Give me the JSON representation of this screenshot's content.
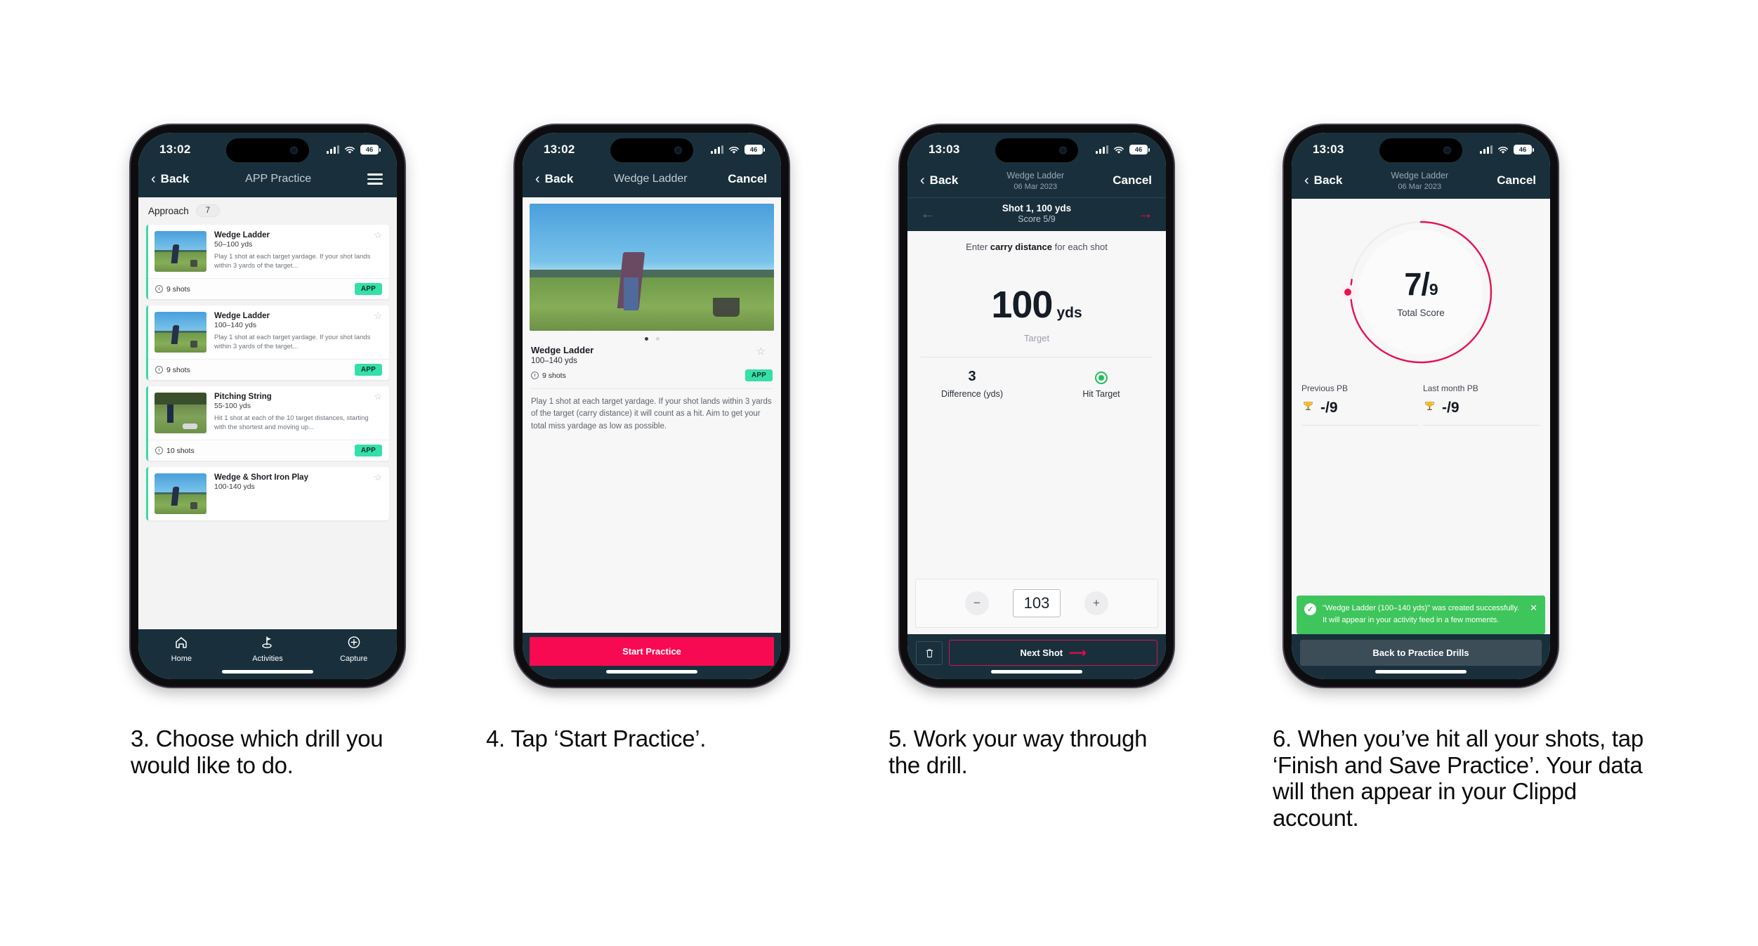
{
  "phones": [
    {
      "id": "phone-approach-list",
      "status": {
        "time": "13:02",
        "battery": "46"
      },
      "nav": {
        "back": "Back",
        "title": "APP Practice",
        "menu_icon": "hamburger-icon"
      },
      "section": {
        "label": "Approach",
        "count": "7"
      },
      "cards": [
        {
          "title": "Wedge Ladder",
          "subtitle": "50–100 yds",
          "description": "Play 1 shot at each target yardage. If your shot lands within 3 yards of the target...",
          "shots": "9 shots",
          "badge": "APP"
        },
        {
          "title": "Wedge Ladder",
          "subtitle": "100–140 yds",
          "description": "Play 1 shot at each target yardage. If your shot lands within 3 yards of the target...",
          "shots": "9 shots",
          "badge": "APP"
        },
        {
          "title": "Pitching String",
          "subtitle": "55-100 yds",
          "description": "Hit 1 shot at each of the 10 target distances, starting with the shortest and moving up...",
          "shots": "10 shots",
          "badge": "APP"
        },
        {
          "title": "Wedge & Short Iron Play",
          "subtitle": "100-140 yds",
          "description": "",
          "shots": "",
          "badge": ""
        }
      ],
      "tabs": [
        {
          "label": "Home",
          "icon": "home-icon"
        },
        {
          "label": "Activities",
          "icon": "golf-flag-icon"
        },
        {
          "label": "Capture",
          "icon": "plus-circle-icon"
        }
      ]
    },
    {
      "id": "phone-drill-detail",
      "status": {
        "time": "13:02",
        "battery": "46"
      },
      "nav": {
        "back": "Back",
        "title": "Wedge Ladder",
        "cancel": "Cancel"
      },
      "detail": {
        "title": "Wedge Ladder",
        "subtitle": "100–140 yds",
        "shots": "9 shots",
        "badge": "APP",
        "description": "Play 1 shot at each target yardage. If your shot lands within 3 yards of the target (carry distance) it will count as a hit. Aim to get your total miss yardage as low as possible.",
        "carousel_dots": 2,
        "active_dot": 0
      },
      "cta": "Start Practice"
    },
    {
      "id": "phone-shot-entry",
      "status": {
        "time": "13:03",
        "battery": "46"
      },
      "nav": {
        "back": "Back",
        "title": "Wedge Ladder",
        "subtitle": "06 Mar 2023",
        "cancel": "Cancel"
      },
      "shotbar": {
        "title": "Shot 1, 100 yds",
        "score": "Score 5/9",
        "prev_icon": "arrow-left-icon",
        "next_icon": "arrow-right-icon"
      },
      "hint_prefix": "Enter ",
      "hint_bold": "carry distance",
      "hint_suffix": " for each shot",
      "target": {
        "value": "100",
        "unit": "yds",
        "caption": "Target"
      },
      "stats": [
        {
          "value": "3",
          "label": "Difference (yds)"
        },
        {
          "value": "",
          "label": "Hit Target",
          "icon": "target-hit-icon"
        }
      ],
      "stepper": {
        "minus": "−",
        "value": "103",
        "plus": "+"
      },
      "footer": {
        "delete_icon": "trash-icon",
        "next": "Next Shot"
      }
    },
    {
      "id": "phone-summary",
      "status": {
        "time": "13:03",
        "battery": "46"
      },
      "nav": {
        "back": "Back",
        "title": "Wedge Ladder",
        "subtitle": "06 Mar 2023",
        "cancel": "Cancel"
      },
      "gauge": {
        "score": "7",
        "divider": "/",
        "total": "9",
        "caption": "Total Score",
        "percent": 77.8,
        "color": "#e8104f"
      },
      "pbs": [
        {
          "label": "Previous PB",
          "value": "-/9",
          "icon": "trophy-icon"
        },
        {
          "label": "Last month PB",
          "value": "-/9",
          "icon": "trophy-icon"
        }
      ],
      "toast": {
        "message": "\"Wedge Ladder (100–140 yds)\" was created successfully. It will appear in your activity feed in a few moments.",
        "close_icon": "close-icon",
        "check_icon": "check-circle-icon",
        "color": "#3ec55b"
      },
      "footer": {
        "button": "Back to Practice Drills"
      }
    }
  ],
  "captions": [
    "3. Choose which drill you would like to do.",
    "4. Tap ‘Start Practice’.",
    "5. Work your way through the drill.",
    "6. When you’ve hit all your shots, tap ‘Finish and Save Practice’. Your data will then appear in your Clippd account."
  ],
  "theme": {
    "navy": "#19303c",
    "pink": "#f70a51",
    "teal": "#35dfa8",
    "green": "#3ec55b"
  }
}
